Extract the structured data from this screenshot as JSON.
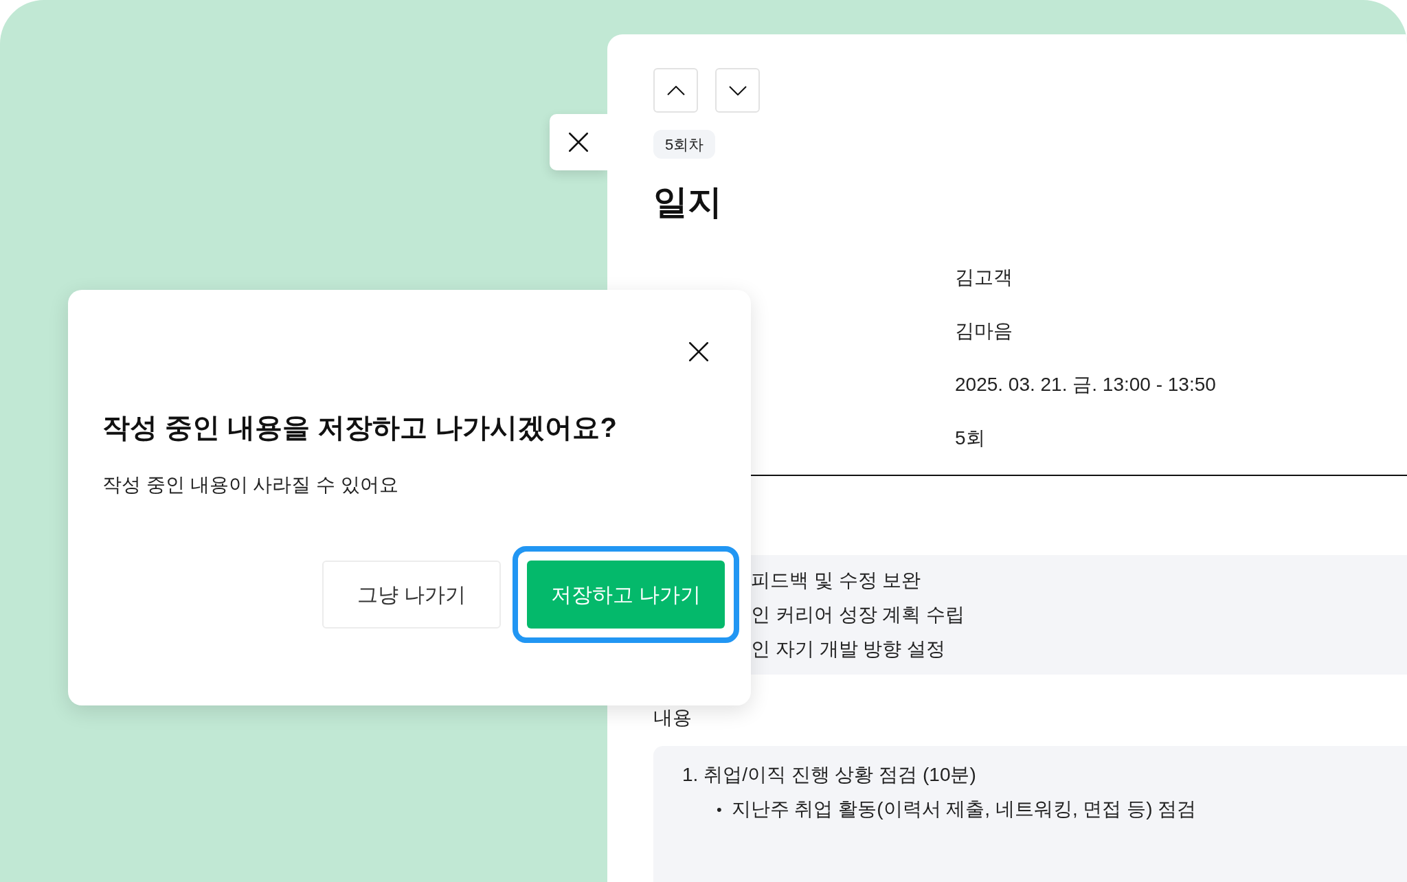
{
  "panel": {
    "badge": "5회차",
    "title": "일지",
    "info_values": [
      "김고객",
      "김마음",
      "2025. 03. 21. 금. 13:00 - 13:50",
      "5회"
    ],
    "goals": [
      "피드백 및 수정 보완",
      "인 커리어 성장 계획 수립",
      "인 자기 개발 방향 설정"
    ],
    "content_label": "내용",
    "content": [
      {
        "kind": "numbered",
        "text": "1. 취업/이직 진행 상황 점검 (10분)"
      },
      {
        "kind": "bullet",
        "marker": "•",
        "text": "지난주 취업 활동(이력서 제출, 네트워킹, 면접 등) 점검"
      }
    ]
  },
  "dialog": {
    "title": "작성 중인 내용을 저장하고 나가시겠어요?",
    "message": "작성 중인 내용이 사라질 수 있어요",
    "buttons": [
      {
        "label": "그냥 나가기",
        "kind": "secondary",
        "focused": false
      },
      {
        "label": "저장하고 나가기",
        "kind": "primary",
        "focused": true
      }
    ]
  }
}
